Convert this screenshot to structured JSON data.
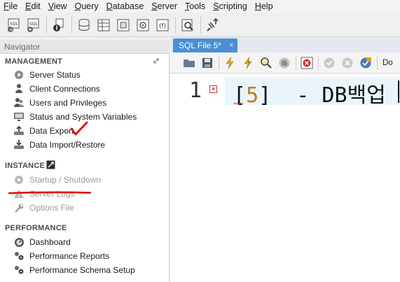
{
  "menubar": {
    "items": [
      {
        "underline": "F",
        "rest": "ile"
      },
      {
        "underline": "E",
        "rest": "dit"
      },
      {
        "underline": "V",
        "rest": "iew"
      },
      {
        "underline": "Q",
        "rest": "uery"
      },
      {
        "underline": "D",
        "rest": "atabase"
      },
      {
        "underline": "S",
        "rest": "erver"
      },
      {
        "underline": "T",
        "rest": "ools"
      },
      {
        "underline": "S",
        "rest": "cripting"
      },
      {
        "underline": "H",
        "rest": "elp"
      }
    ]
  },
  "toolbar": {
    "icons": [
      "new-sql-tab-icon",
      "open-sql-script-icon",
      "info-icon",
      "create-schema-icon",
      "create-table-icon",
      "create-view-icon",
      "create-procedure-icon",
      "create-function-icon",
      "search-table-data-icon",
      "reconnect-icon"
    ]
  },
  "navigator": {
    "header": "Navigator",
    "management": {
      "title": "MANAGEMENT",
      "items": [
        "Server Status",
        "Client Connections",
        "Users and Privileges",
        "Status and System Variables",
        "Data Export",
        "Data Import/Restore"
      ]
    },
    "instance": {
      "title": "INSTANCE",
      "items": [
        "Startup / Shutdown",
        "Server Logs",
        "Options File"
      ]
    },
    "performance": {
      "title": "PERFORMANCE",
      "items": [
        "Dashboard",
        "Performance Reports",
        "Performance Schema Setup"
      ]
    }
  },
  "editor": {
    "tab_label": "SQL File 5*",
    "tab_close": "×",
    "toolbar_trailing_text": "Do",
    "line_number": "1",
    "error_marker": "×",
    "code_open": "[",
    "code_number": "5",
    "code_rest": "]  - DB백업"
  },
  "colors": {
    "tab_active": "#4a8fd4",
    "current_line": "#eaf5fb",
    "number_literal": "#c27b1a",
    "annotation_red": "#e01010"
  }
}
